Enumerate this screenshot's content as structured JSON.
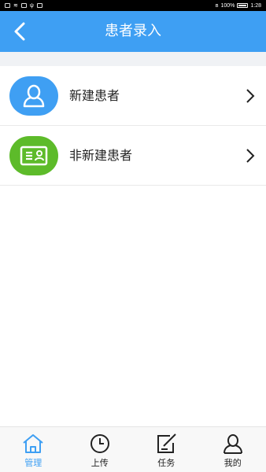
{
  "status_bar": {
    "battery_percent": "100%",
    "time": "1:28"
  },
  "header": {
    "title": "患者录入"
  },
  "list": {
    "items": [
      {
        "label": "新建患者",
        "icon": "person-icon",
        "color": "#3f9ff3"
      },
      {
        "label": "非新建患者",
        "icon": "id-card-icon",
        "color": "#5dbb2a"
      }
    ]
  },
  "tabs": [
    {
      "label": "管理",
      "icon": "home-icon",
      "active": true
    },
    {
      "label": "上传",
      "icon": "clock-icon",
      "active": false
    },
    {
      "label": "任务",
      "icon": "edit-icon",
      "active": false
    },
    {
      "label": "我的",
      "icon": "user-icon",
      "active": false
    }
  ],
  "colors": {
    "accent": "#3e9ff3",
    "green": "#5dbb2a"
  }
}
